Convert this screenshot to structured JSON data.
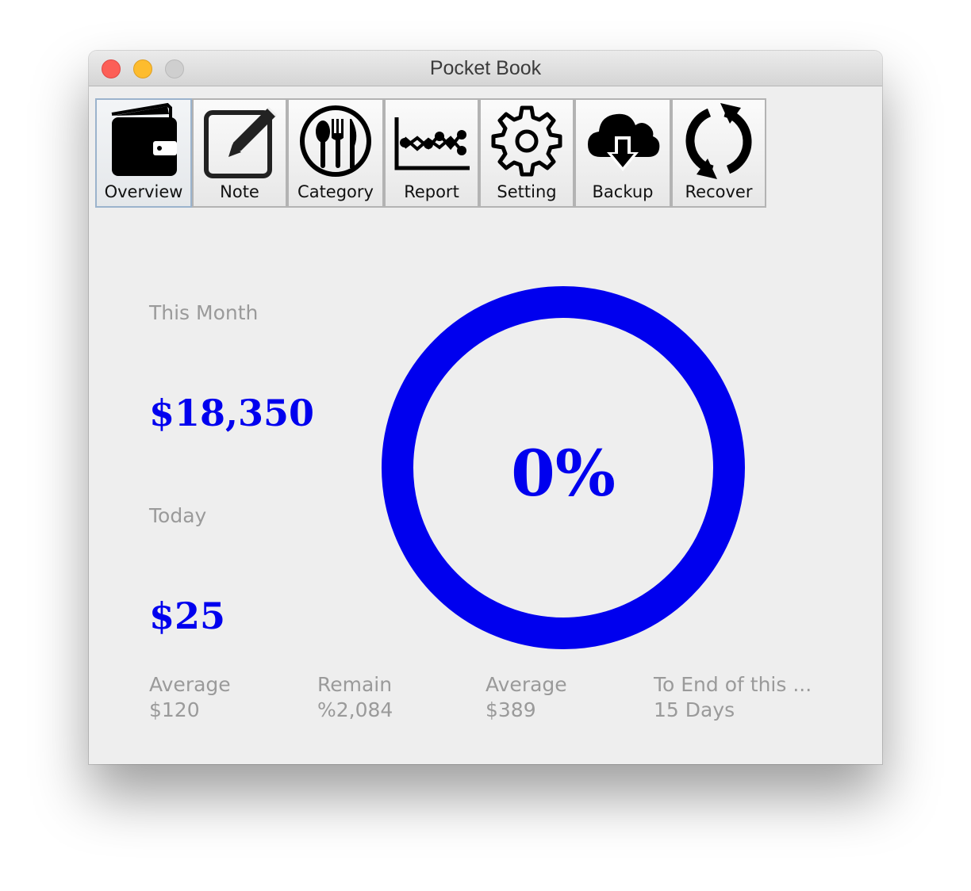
{
  "window": {
    "title": "Pocket Book"
  },
  "toolbar": {
    "items": [
      {
        "label": "Overview",
        "icon": "wallet-icon",
        "active": true
      },
      {
        "label": "Note",
        "icon": "edit-note-icon"
      },
      {
        "label": "Category",
        "icon": "cutlery-icon"
      },
      {
        "label": "Report",
        "icon": "line-chart-icon"
      },
      {
        "label": "Setting",
        "icon": "gear-icon"
      },
      {
        "label": "Backup",
        "icon": "cloud-download-icon"
      },
      {
        "label": "Recover",
        "icon": "refresh-icon"
      }
    ]
  },
  "overview": {
    "this_month_label": "This Month",
    "this_month_value": "$18,350",
    "today_label": "Today",
    "today_value": "$25",
    "gauge_text": "0%",
    "gauge_percent": 0
  },
  "footer": {
    "cells": [
      {
        "label": "Average",
        "value": "$120"
      },
      {
        "label": "Remain",
        "value": "%2,084"
      },
      {
        "label": "Average",
        "value": "$389"
      },
      {
        "label": "To End of this ...",
        "value": "15 Days"
      }
    ]
  },
  "colors": {
    "accent": "#0000ee",
    "muted_text": "#9a9a9a",
    "window_bg": "#eeeeee",
    "close": "#fc5f57",
    "minimize": "#fdbc2e",
    "maximize": "#cfcfcf"
  }
}
